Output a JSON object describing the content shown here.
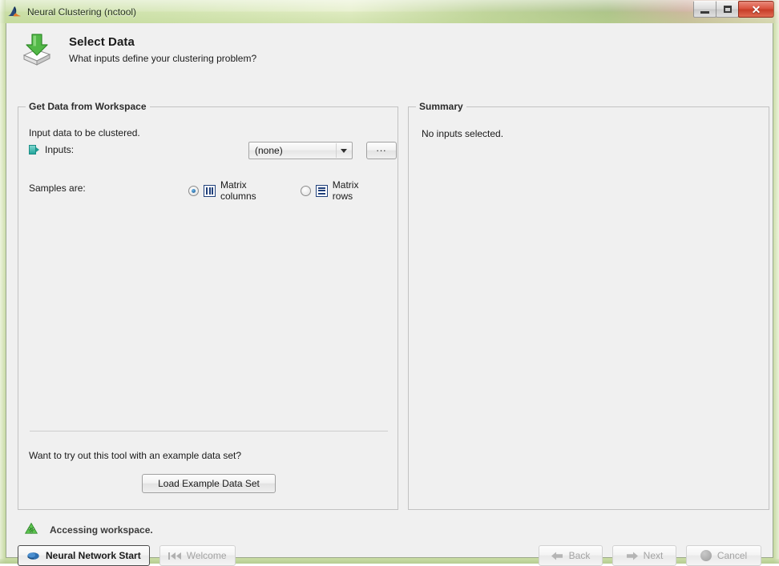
{
  "window": {
    "title": "Neural Clustering (nctool)",
    "logo_icon": "matlab-membrane-icon",
    "controls": {
      "minimize": "minimize-icon",
      "maximize": "maximize-icon",
      "close": "✕"
    }
  },
  "header": {
    "icon": "import-data-arrow-icon",
    "title": "Select Data",
    "subtitle": "What inputs define your clustering problem?"
  },
  "left_panel": {
    "legend": "Get Data from Workspace",
    "input_description": "Input data to be clustered.",
    "inputs_label": "Inputs:",
    "inputs_icon": "input-vector-icon",
    "inputs_value": "(none)",
    "inputs_options": [
      "(none)"
    ],
    "browse_label": "...",
    "samples_label": "Samples are:",
    "radio_options": [
      {
        "label": "Matrix columns",
        "selected": true,
        "icon": "matrix-columns-icon"
      },
      {
        "label": "Matrix rows",
        "selected": false,
        "icon": "matrix-rows-icon"
      }
    ],
    "example_question": "Want to try out this tool with an example data set?",
    "example_button": "Load Example Data Set"
  },
  "right_panel": {
    "legend": "Summary",
    "summary_text": "No inputs selected."
  },
  "status": {
    "icon": "recycle-icon",
    "text": "Accessing workspace."
  },
  "footer": {
    "left_buttons": [
      {
        "label": "Neural Network Start",
        "icon": "brain-icon",
        "enabled": true
      },
      {
        "label": "Welcome",
        "icon": "rewind-icon",
        "enabled": false
      }
    ],
    "right_buttons": [
      {
        "label": "Back",
        "icon": "arrow-left-icon",
        "enabled": false
      },
      {
        "label": "Next",
        "icon": "arrow-right-icon",
        "enabled": false
      },
      {
        "label": "Cancel",
        "icon": "cancel-circle-icon",
        "enabled": false
      }
    ]
  },
  "colors": {
    "titlebar_green": "#cfe0a8",
    "close_red": "#d9503c",
    "accent_green": "#52b847",
    "input_teal": "#23a69c",
    "panel_bg": "#f0f0f0"
  }
}
